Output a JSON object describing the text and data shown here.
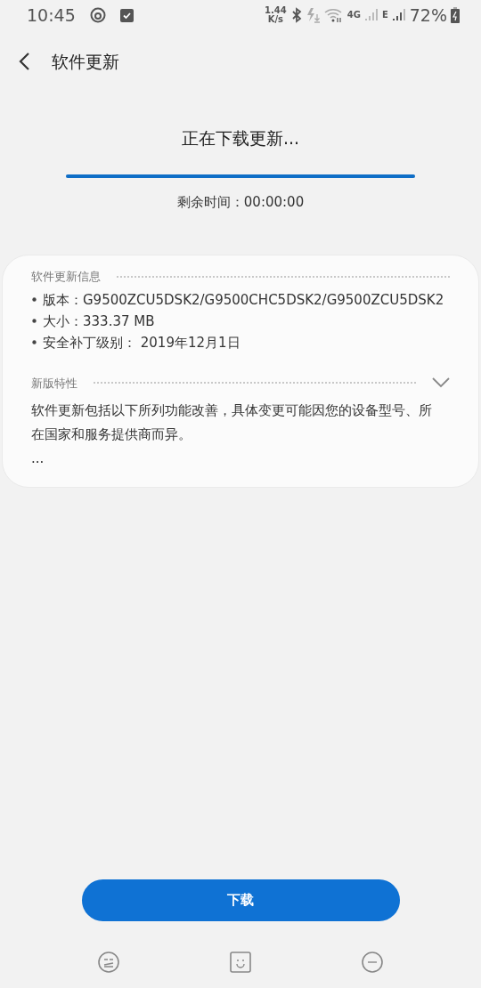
{
  "status_bar": {
    "time": "10:45",
    "speed_value": "1.44",
    "speed_unit": "K/s",
    "network": "4G",
    "network_secondary": "E",
    "battery": "72%"
  },
  "header": {
    "title": "软件更新"
  },
  "download": {
    "heading": "正在下载更新...",
    "level": 1,
    "remaining": "剩余时间：00:00:00"
  },
  "info": {
    "title": "软件更新信息",
    "items": [
      "版本：G9500ZCU5DSK2/G9500CHC5DSK2/G9500ZCU5DSK2",
      "大小：333.37 MB",
      "安全补丁级别： 2019年12月1日"
    ]
  },
  "features": {
    "title": "新版特性",
    "expanded": false,
    "text": "软件更新包括以下所列功能改善，具体变更可能因您的设备型号、所在国家和服务提供商而异。",
    "more": "..."
  },
  "button": {
    "label": "下载"
  }
}
